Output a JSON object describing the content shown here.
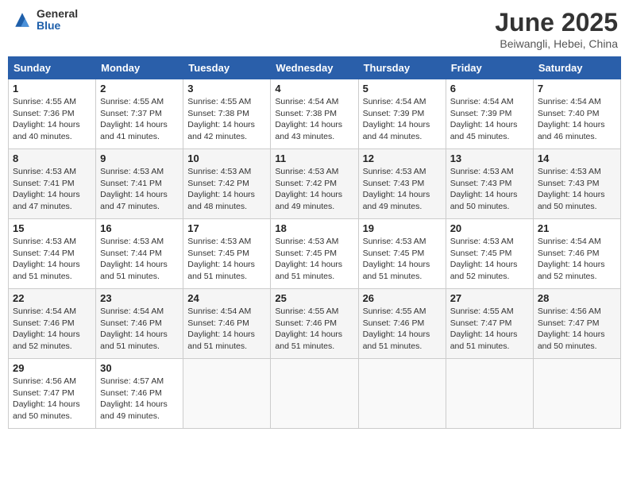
{
  "header": {
    "logo_general": "General",
    "logo_blue": "Blue",
    "month_title": "June 2025",
    "location": "Beiwangli, Hebei, China"
  },
  "weekdays": [
    "Sunday",
    "Monday",
    "Tuesday",
    "Wednesday",
    "Thursday",
    "Friday",
    "Saturday"
  ],
  "weeks": [
    [
      {
        "day": "1",
        "sunrise": "Sunrise: 4:55 AM",
        "sunset": "Sunset: 7:36 PM",
        "daylight": "Daylight: 14 hours and 40 minutes."
      },
      {
        "day": "2",
        "sunrise": "Sunrise: 4:55 AM",
        "sunset": "Sunset: 7:37 PM",
        "daylight": "Daylight: 14 hours and 41 minutes."
      },
      {
        "day": "3",
        "sunrise": "Sunrise: 4:55 AM",
        "sunset": "Sunset: 7:38 PM",
        "daylight": "Daylight: 14 hours and 42 minutes."
      },
      {
        "day": "4",
        "sunrise": "Sunrise: 4:54 AM",
        "sunset": "Sunset: 7:38 PM",
        "daylight": "Daylight: 14 hours and 43 minutes."
      },
      {
        "day": "5",
        "sunrise": "Sunrise: 4:54 AM",
        "sunset": "Sunset: 7:39 PM",
        "daylight": "Daylight: 14 hours and 44 minutes."
      },
      {
        "day": "6",
        "sunrise": "Sunrise: 4:54 AM",
        "sunset": "Sunset: 7:39 PM",
        "daylight": "Daylight: 14 hours and 45 minutes."
      },
      {
        "day": "7",
        "sunrise": "Sunrise: 4:54 AM",
        "sunset": "Sunset: 7:40 PM",
        "daylight": "Daylight: 14 hours and 46 minutes."
      }
    ],
    [
      {
        "day": "8",
        "sunrise": "Sunrise: 4:53 AM",
        "sunset": "Sunset: 7:41 PM",
        "daylight": "Daylight: 14 hours and 47 minutes."
      },
      {
        "day": "9",
        "sunrise": "Sunrise: 4:53 AM",
        "sunset": "Sunset: 7:41 PM",
        "daylight": "Daylight: 14 hours and 47 minutes."
      },
      {
        "day": "10",
        "sunrise": "Sunrise: 4:53 AM",
        "sunset": "Sunset: 7:42 PM",
        "daylight": "Daylight: 14 hours and 48 minutes."
      },
      {
        "day": "11",
        "sunrise": "Sunrise: 4:53 AM",
        "sunset": "Sunset: 7:42 PM",
        "daylight": "Daylight: 14 hours and 49 minutes."
      },
      {
        "day": "12",
        "sunrise": "Sunrise: 4:53 AM",
        "sunset": "Sunset: 7:43 PM",
        "daylight": "Daylight: 14 hours and 49 minutes."
      },
      {
        "day": "13",
        "sunrise": "Sunrise: 4:53 AM",
        "sunset": "Sunset: 7:43 PM",
        "daylight": "Daylight: 14 hours and 50 minutes."
      },
      {
        "day": "14",
        "sunrise": "Sunrise: 4:53 AM",
        "sunset": "Sunset: 7:43 PM",
        "daylight": "Daylight: 14 hours and 50 minutes."
      }
    ],
    [
      {
        "day": "15",
        "sunrise": "Sunrise: 4:53 AM",
        "sunset": "Sunset: 7:44 PM",
        "daylight": "Daylight: 14 hours and 51 minutes."
      },
      {
        "day": "16",
        "sunrise": "Sunrise: 4:53 AM",
        "sunset": "Sunset: 7:44 PM",
        "daylight": "Daylight: 14 hours and 51 minutes."
      },
      {
        "day": "17",
        "sunrise": "Sunrise: 4:53 AM",
        "sunset": "Sunset: 7:45 PM",
        "daylight": "Daylight: 14 hours and 51 minutes."
      },
      {
        "day": "18",
        "sunrise": "Sunrise: 4:53 AM",
        "sunset": "Sunset: 7:45 PM",
        "daylight": "Daylight: 14 hours and 51 minutes."
      },
      {
        "day": "19",
        "sunrise": "Sunrise: 4:53 AM",
        "sunset": "Sunset: 7:45 PM",
        "daylight": "Daylight: 14 hours and 51 minutes."
      },
      {
        "day": "20",
        "sunrise": "Sunrise: 4:53 AM",
        "sunset": "Sunset: 7:45 PM",
        "daylight": "Daylight: 14 hours and 52 minutes."
      },
      {
        "day": "21",
        "sunrise": "Sunrise: 4:54 AM",
        "sunset": "Sunset: 7:46 PM",
        "daylight": "Daylight: 14 hours and 52 minutes."
      }
    ],
    [
      {
        "day": "22",
        "sunrise": "Sunrise: 4:54 AM",
        "sunset": "Sunset: 7:46 PM",
        "daylight": "Daylight: 14 hours and 52 minutes."
      },
      {
        "day": "23",
        "sunrise": "Sunrise: 4:54 AM",
        "sunset": "Sunset: 7:46 PM",
        "daylight": "Daylight: 14 hours and 51 minutes."
      },
      {
        "day": "24",
        "sunrise": "Sunrise: 4:54 AM",
        "sunset": "Sunset: 7:46 PM",
        "daylight": "Daylight: 14 hours and 51 minutes."
      },
      {
        "day": "25",
        "sunrise": "Sunrise: 4:55 AM",
        "sunset": "Sunset: 7:46 PM",
        "daylight": "Daylight: 14 hours and 51 minutes."
      },
      {
        "day": "26",
        "sunrise": "Sunrise: 4:55 AM",
        "sunset": "Sunset: 7:46 PM",
        "daylight": "Daylight: 14 hours and 51 minutes."
      },
      {
        "day": "27",
        "sunrise": "Sunrise: 4:55 AM",
        "sunset": "Sunset: 7:47 PM",
        "daylight": "Daylight: 14 hours and 51 minutes."
      },
      {
        "day": "28",
        "sunrise": "Sunrise: 4:56 AM",
        "sunset": "Sunset: 7:47 PM",
        "daylight": "Daylight: 14 hours and 50 minutes."
      }
    ],
    [
      {
        "day": "29",
        "sunrise": "Sunrise: 4:56 AM",
        "sunset": "Sunset: 7:47 PM",
        "daylight": "Daylight: 14 hours and 50 minutes."
      },
      {
        "day": "30",
        "sunrise": "Sunrise: 4:57 AM",
        "sunset": "Sunset: 7:46 PM",
        "daylight": "Daylight: 14 hours and 49 minutes."
      },
      null,
      null,
      null,
      null,
      null
    ]
  ]
}
